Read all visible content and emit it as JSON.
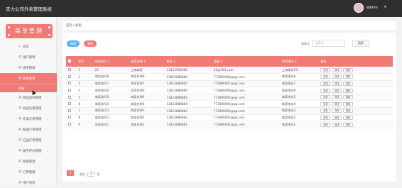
{
  "header": {
    "title": "吉力公司外卖管理系统",
    "user": "admin",
    "caret": "▾"
  },
  "sidebar": {
    "logo": "菜单管理",
    "items": [
      {
        "icon": "⌂",
        "label": "首页",
        "chev": ""
      },
      {
        "icon": "▤",
        "label": "用户管理",
        "chev": "⌄"
      },
      {
        "icon": "▤",
        "label": "骑手管理",
        "chev": "⌄"
      },
      {
        "icon": "▤",
        "label": "商家管理",
        "chev": "⌃",
        "active": true
      },
      {
        "icon": "▤",
        "label": "商品类别管理",
        "chev": "⌄"
      },
      {
        "icon": "▤",
        "label": "商品信息管理",
        "chev": "⌄"
      },
      {
        "icon": "▤",
        "label": "外卖订单管理",
        "chev": "⌄"
      },
      {
        "icon": "▤",
        "label": "配送订单管理",
        "chev": "⌄"
      },
      {
        "icon": "▤",
        "label": "已送订单管理",
        "chev": "⌄"
      },
      {
        "icon": "▤",
        "label": "骑手评价管理",
        "chev": "⌄"
      },
      {
        "icon": "▤",
        "label": "系统管理",
        "chev": "⌄"
      },
      {
        "icon": "▤",
        "label": "订单管理",
        "chev": "⌄"
      },
      {
        "icon": "▤",
        "label": "用户资料",
        "chev": "⌄"
      }
    ],
    "sub_item": "商家"
  },
  "breadcrumb": "首页 / 商家",
  "toolbar": {
    "add": "新增",
    "delete": "删除",
    "search_label": "商家名",
    "search_placeholder": "商家名",
    "search_btn": "搜索"
  },
  "table": {
    "headers": [
      "",
      "索引",
      "商家账号 ⇕",
      "商家名称 ⇕",
      "电话 ⇕",
      "邮箱 ⇕",
      "商家地址 ⇕",
      "操作"
    ],
    "rows": [
      [
        "1",
        "22",
        "上海商家",
        "13553556666",
        "22@163.com",
        "上海浦东5号"
      ],
      [
        "2",
        "商家账号8",
        "商家名称8",
        "13823888888",
        "773890008@qq.com",
        "商家地址8"
      ],
      [
        "3",
        "商家账号7",
        "商家名称7",
        "13823888887",
        "773890007@qq.com",
        "商家地址7"
      ],
      [
        "4",
        "商家账号6",
        "商家名称6",
        "13823888886",
        "773890006@qq.com",
        "商家地址6"
      ],
      [
        "5",
        "商家账号5",
        "商家名称5",
        "13823888885",
        "773890005@qq.com",
        "商家地址5"
      ],
      [
        "6",
        "商家账号4",
        "商家名称4",
        "13823888884",
        "773890004@qq.com",
        "商家地址4"
      ],
      [
        "7",
        "商家账号3",
        "商家名称3",
        "13823888883",
        "773890003@qq.com",
        "商家地址3"
      ],
      [
        "8",
        "商家账号2",
        "商家名称2",
        "13823888882",
        "773890002@qq.com",
        "商家地址2"
      ],
      [
        "9",
        "商家账号1",
        "商家名称1",
        "13823888881",
        "773890001@qq.com",
        "商家地址1"
      ]
    ],
    "ops": [
      "查看",
      "修改",
      "删除"
    ]
  },
  "pager": {
    "current": "1",
    "goto": "前往",
    "page_value": "1",
    "page_unit": "页"
  },
  "colors": {
    "accent": "#f07a76",
    "add": "#5bb5f0",
    "topbar": "#2f2f2f"
  }
}
